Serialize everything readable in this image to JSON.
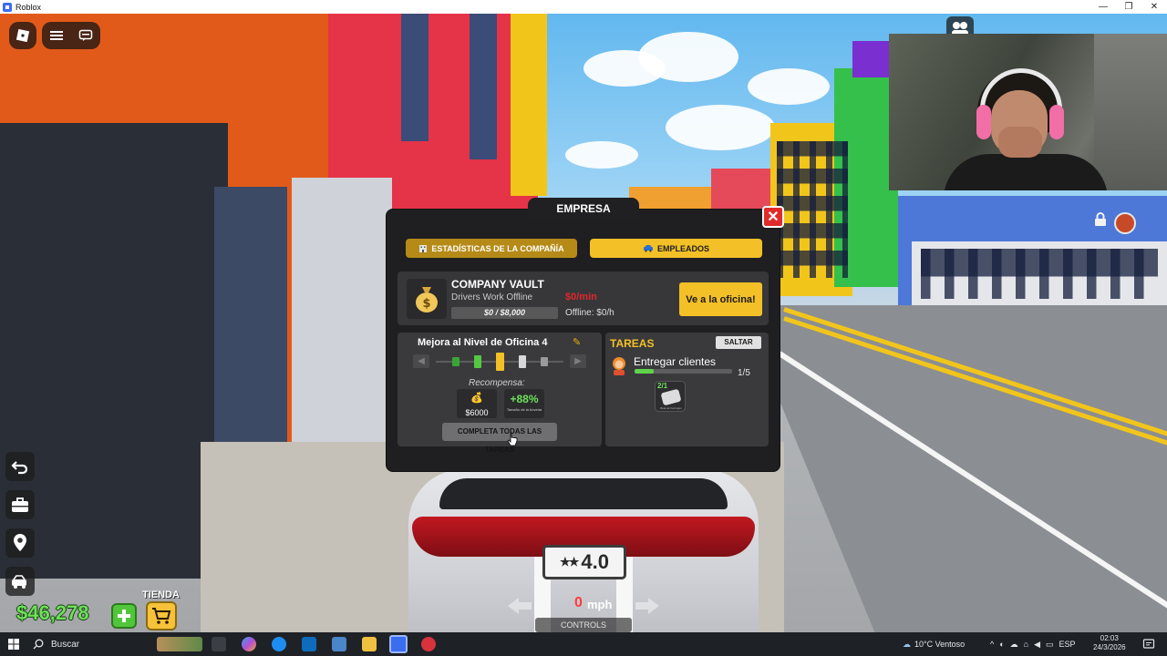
{
  "window": {
    "title": "Roblox",
    "controls": [
      "—",
      "❐",
      "✕"
    ]
  },
  "hud": {
    "money": "$46,278",
    "shop_label": "TIENDA",
    "speed_value": "0",
    "speed_unit": "mph",
    "controls_label": "CONTROLS",
    "plate_text": "4.0"
  },
  "panel": {
    "title": "EMPRESA",
    "close": "✕",
    "tabs": {
      "stats": "ESTADÍSTICAS DE LA COMPAÑÍA",
      "employees": "EMPLEADOS"
    },
    "vault": {
      "title": "COMPANY VAULT",
      "subtitle": "Drivers Work Offline",
      "progress_text": "$0 / $8,000",
      "progress_fraction": 0,
      "rate": "$0/min",
      "offline": "Offline: $0/h",
      "office_button": "Ve a la oficina!"
    },
    "upgrade": {
      "title": "Mejora al Nivel de Oficina 4",
      "reward_label": "Recompensa:",
      "reward_money": "$6000",
      "reward_percent": "+88%",
      "reward_percent_caption": "Tamaño de la bóveda",
      "complete_button": "COMPLETA TODAS LAS TAREAS"
    },
    "tasks": {
      "title": "TAREAS",
      "skip_button": "SALTAR",
      "task_name": "Entregar clientes",
      "task_count": "1/5",
      "task_progress_fraction": 0.2,
      "item_badge": "2/1",
      "item_caption": "Bola de hormigón"
    }
  },
  "taskbar": {
    "search_placeholder": "Buscar",
    "weather": "10°C Ventoso",
    "language": "ESP",
    "time": "02:03",
    "date": "24/3/2026"
  },
  "colors": {
    "accent_yellow": "#f3c028",
    "accent_gold": "#b58a17",
    "close_red": "#e02b2b",
    "money_green": "#6fe05a",
    "panel_bg": "#1f1f21"
  }
}
